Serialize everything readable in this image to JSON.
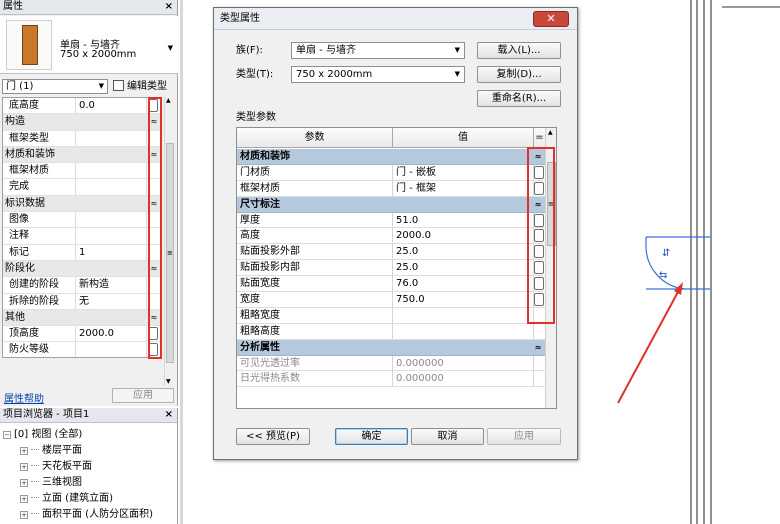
{
  "properties_panel": {
    "title": "属性",
    "close": "×",
    "type_line1": "单扇 - 与墙齐",
    "type_line2": "750 x 2000mm",
    "instance_selector": "门 (1)",
    "edit_type": "编辑类型",
    "rows": [
      {
        "kind": "param",
        "key": "底高度",
        "value": "0.0",
        "button": true
      },
      {
        "kind": "group",
        "key": "构造"
      },
      {
        "kind": "param",
        "key": "框架类型",
        "value": ""
      },
      {
        "kind": "group",
        "key": "材质和装饰"
      },
      {
        "kind": "param",
        "key": "框架材质",
        "value": ""
      },
      {
        "kind": "param",
        "key": "完成",
        "value": ""
      },
      {
        "kind": "group",
        "key": "标识数据"
      },
      {
        "kind": "param",
        "key": "图像",
        "value": ""
      },
      {
        "kind": "param",
        "key": "注释",
        "value": ""
      },
      {
        "kind": "param",
        "key": "标记",
        "value": "1"
      },
      {
        "kind": "group",
        "key": "阶段化"
      },
      {
        "kind": "param",
        "key": "创建的阶段",
        "value": "新构造"
      },
      {
        "kind": "param",
        "key": "拆除的阶段",
        "value": "无"
      },
      {
        "kind": "group",
        "key": "其他"
      },
      {
        "kind": "param",
        "key": "顶高度",
        "value": "2000.0",
        "button": true
      },
      {
        "kind": "param",
        "key": "防火等级",
        "value": "",
        "button": true
      }
    ],
    "help_link": "属性帮助",
    "apply_button": "应用"
  },
  "project_browser": {
    "title": "项目浏览器 - 项目1",
    "close": "×",
    "root": "[0] 视图 (全部)",
    "items": [
      "楼层平面",
      "天花板平面",
      "三维视图",
      "立面 (建筑立面)",
      "面积平面 (人防分区面积)"
    ]
  },
  "dialog": {
    "title": "类型属性",
    "close": "✕",
    "family_label": "族(F):",
    "family_value": "单扇 - 与墙齐",
    "type_label": "类型(T):",
    "type_value": "750 x 2000mm",
    "load_button": "载入(L)...",
    "duplicate_button": "复制(D)...",
    "rename_button": "重命名(R)...",
    "params_label": "类型参数",
    "col_param": "参数",
    "col_value": "值",
    "col_eq": "=",
    "rows": [
      {
        "kind": "group",
        "key": "材质和装饰"
      },
      {
        "kind": "param",
        "key": "门材质",
        "value": "门 - 嵌板",
        "button": true
      },
      {
        "kind": "param",
        "key": "框架材质",
        "value": "门 - 框架",
        "button": true
      },
      {
        "kind": "group",
        "key": "尺寸标注"
      },
      {
        "kind": "param",
        "key": "厚度",
        "value": "51.0",
        "button": true
      },
      {
        "kind": "param",
        "key": "高度",
        "value": "2000.0",
        "button": true
      },
      {
        "kind": "param",
        "key": "贴面投影外部",
        "value": "25.0",
        "button": true
      },
      {
        "kind": "param",
        "key": "贴面投影内部",
        "value": "25.0",
        "button": true
      },
      {
        "kind": "param",
        "key": "贴面宽度",
        "value": "76.0",
        "button": true
      },
      {
        "kind": "param",
        "key": "宽度",
        "value": "750.0",
        "button": true
      },
      {
        "kind": "param",
        "key": "粗略宽度",
        "value": ""
      },
      {
        "kind": "param",
        "key": "粗略高度",
        "value": ""
      },
      {
        "kind": "group",
        "key": "分析属性"
      },
      {
        "kind": "param",
        "key": "可见光透过率",
        "value": "0.000000",
        "dim": true
      },
      {
        "kind": "param",
        "key": "日光得热系数",
        "value": "0.000000",
        "dim": true
      }
    ],
    "preview_button": "<< 预览(P)",
    "ok_button": "确定",
    "cancel_button": "取消",
    "apply_button": "应用"
  },
  "icons": {
    "collapse": "≈",
    "dropdown": "▼",
    "expand": "⊞"
  },
  "accent_colors": {
    "annotation_red": "#e2312b",
    "group_row_blue": "#b6c8dd",
    "door_blue": "#3b6fd9"
  }
}
